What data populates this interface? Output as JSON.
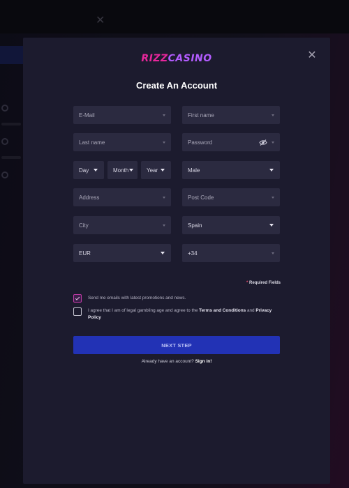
{
  "logo": {
    "part1": "RIZZ",
    "part2": "CASINO"
  },
  "title": "Create An Account",
  "fields": {
    "email": "E-Mail",
    "first_name": "First name",
    "last_name": "Last name",
    "password": "Password",
    "day": "Day",
    "month": "Month",
    "year": "Year",
    "gender": "Male",
    "address": "Address",
    "post_code": "Post Code",
    "city": "City",
    "country": "Spain",
    "currency": "EUR",
    "phone_prefix": "+34"
  },
  "required": {
    "star": "*",
    "text": "Required Fields"
  },
  "consents": {
    "promo": {
      "checked": true,
      "text": "Send me emails with latest promotions and news."
    },
    "terms": {
      "checked": false,
      "pre": "I agree that I am of legal gambling age and agree to the",
      "terms_link": "Terms and Conditions",
      "mid": "and",
      "privacy_link": "Privacy Policy"
    }
  },
  "next_button": "NEXT STEP",
  "signin": {
    "text": "Already have an account?",
    "link": "Sign in!"
  },
  "icons": [
    "close-icon",
    "eye-off-icon",
    "chevron-down-icon",
    "checkmark-icon"
  ],
  "colors": {
    "modal_bg": "#1c1b2e",
    "field_bg": "#2b2a40",
    "button": "#2232b5",
    "logo_pink": "#e7269b",
    "logo_purple": "#b35cff"
  }
}
